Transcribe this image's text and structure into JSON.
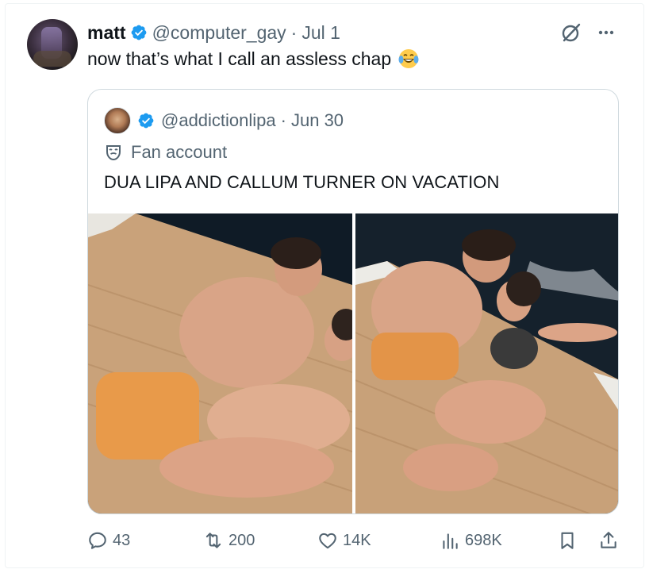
{
  "tweet": {
    "author_name": "matt",
    "author_handle": "@computer_gay",
    "separator": "·",
    "date": "Jul 1",
    "text": "now that’s what I call an assless chap",
    "emoji": "face-with-tears-of-joy"
  },
  "quoted": {
    "handle": "@addictionlipa",
    "separator": "·",
    "date": "Jun 30",
    "label": "Fan account",
    "text": "DUA LIPA AND CALLUM TURNER ON VACATION",
    "images": [
      {
        "icon": "photo-left"
      },
      {
        "icon": "photo-right"
      }
    ]
  },
  "actions": {
    "replies": "43",
    "reposts": "200",
    "likes": "14K",
    "views": "698K"
  },
  "colors": {
    "verified": "#1d9bf0",
    "muted": "#536471",
    "text": "#0f1419",
    "border": "#cfd9de"
  }
}
